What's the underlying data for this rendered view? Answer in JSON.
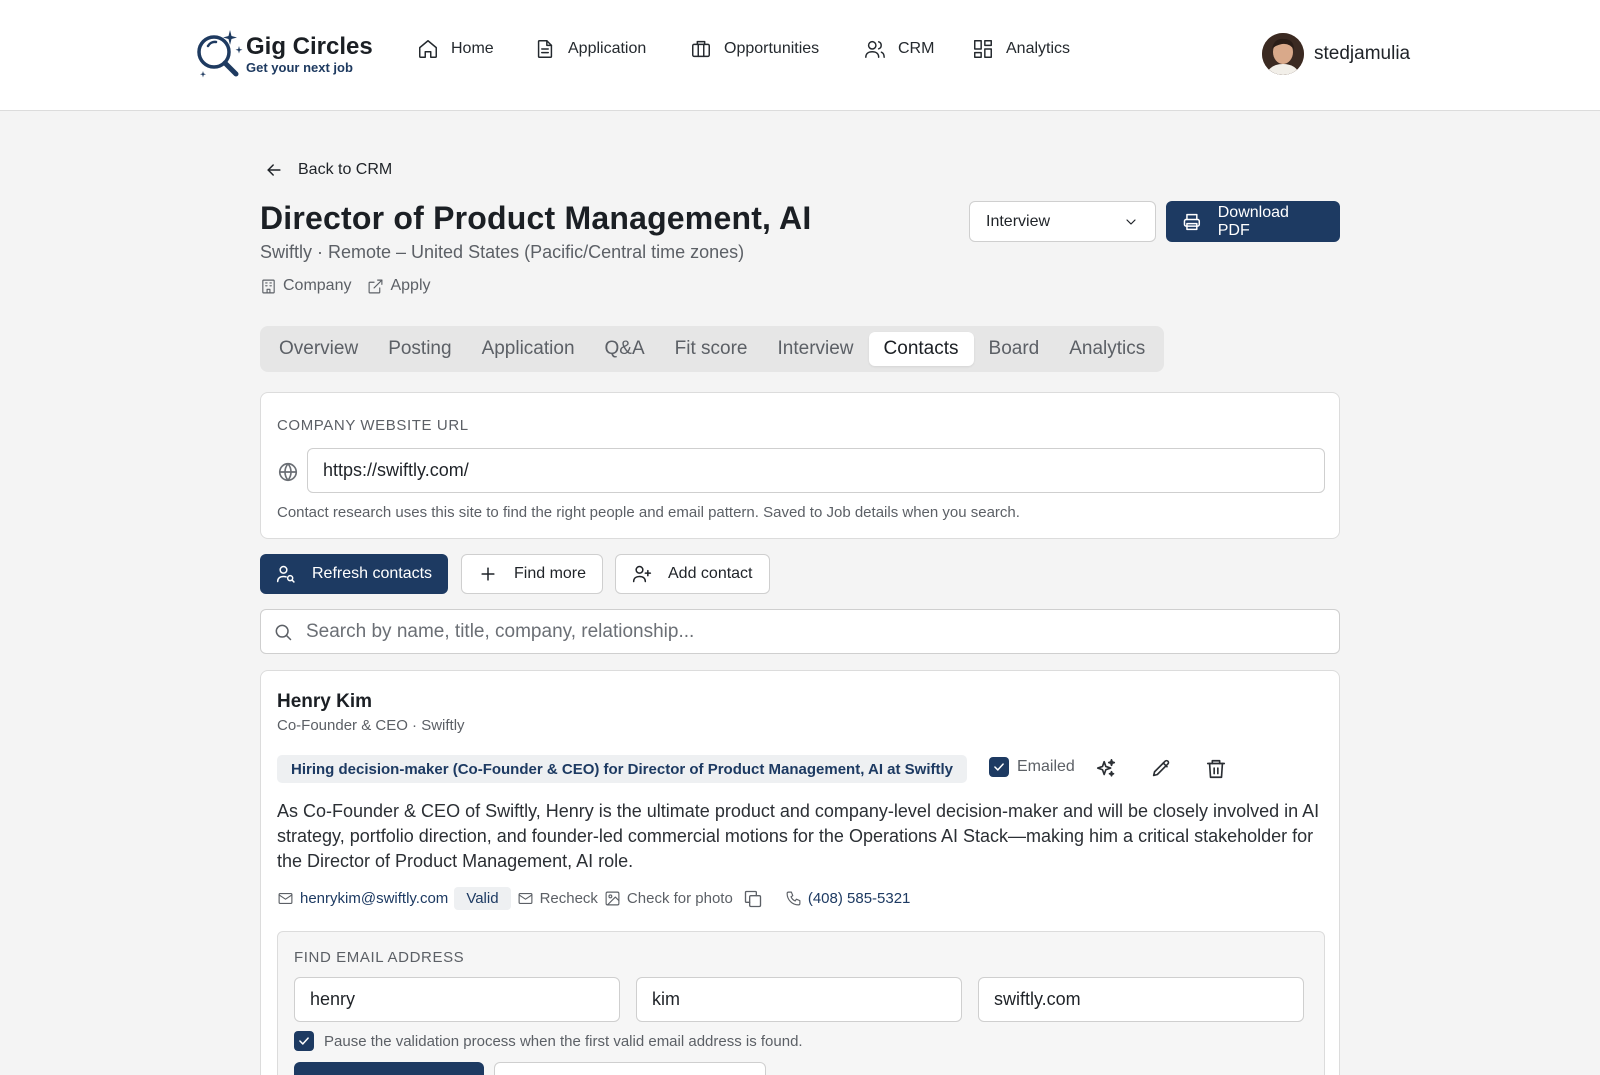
{
  "brand": {
    "name": "Gig Circles",
    "tagline": "Get your next job"
  },
  "nav": [
    {
      "label": "Home",
      "icon": "home-icon"
    },
    {
      "label": "Application",
      "icon": "file-text-icon"
    },
    {
      "label": "Opportunities",
      "icon": "briefcase-icon"
    },
    {
      "label": "CRM",
      "icon": "users-icon"
    },
    {
      "label": "Analytics",
      "icon": "dashboard-grid-icon"
    }
  ],
  "user": {
    "name": "stedjamulia"
  },
  "back": {
    "label": "Back to CRM"
  },
  "job": {
    "title": "Director of Product Management, AI",
    "subtitle": "Swiftly · Remote – United States (Pacific/Central time zones)",
    "company_link": "Company",
    "apply_link": "Apply"
  },
  "status": {
    "selected": "Interview"
  },
  "download": {
    "label": "Download PDF"
  },
  "tabs": [
    {
      "label": "Overview",
      "active": false
    },
    {
      "label": "Posting",
      "active": false
    },
    {
      "label": "Application",
      "active": false
    },
    {
      "label": "Q&A",
      "active": false
    },
    {
      "label": "Fit score",
      "active": false
    },
    {
      "label": "Interview",
      "active": false
    },
    {
      "label": "Contacts",
      "active": true
    },
    {
      "label": "Board",
      "active": false
    },
    {
      "label": "Analytics",
      "active": false
    }
  ],
  "website": {
    "label": "Company website URL",
    "value": "https://swiftly.com/",
    "hint": "Contact research uses this site to find the right people and email pattern. Saved to Job details when you search."
  },
  "actions": {
    "refresh": "Refresh contacts",
    "find_more": "Find more",
    "add_contact": "Add contact"
  },
  "search": {
    "placeholder": "Search by name, title, company, relationship..."
  },
  "contact": {
    "name": "Henry Kim",
    "role": "Co-Founder & CEO · Swiftly",
    "badge": "Hiring decision-maker (Co-Founder & CEO) for Director of Product Management, AI at Swiftly",
    "emailed_label": "Emailed",
    "emailed": true,
    "description": "As Co-Founder & CEO of Swiftly, Henry is the ultimate product and company-level decision-maker and will be closely involved in AI strategy, portfolio direction, and founder-led commercial motions for the Operations AI Stack—making him a critical stakeholder for the Director of Product Management, AI role.",
    "email": "henrykim@swiftly.com",
    "email_status": "Valid",
    "recheck": "Recheck",
    "check_photo": "Check for photo",
    "phone": "(408) 585-5321"
  },
  "find_email": {
    "label": "Find email address",
    "first_name": "henry",
    "last_name": "kim",
    "domain": "swiftly.com",
    "pause_label": "Pause the validation process when the first valid email address is found.",
    "pause_checked": true
  },
  "colors": {
    "primary": "#1d3a62",
    "background": "#f4f4f4",
    "muted_text": "#5c6066"
  }
}
